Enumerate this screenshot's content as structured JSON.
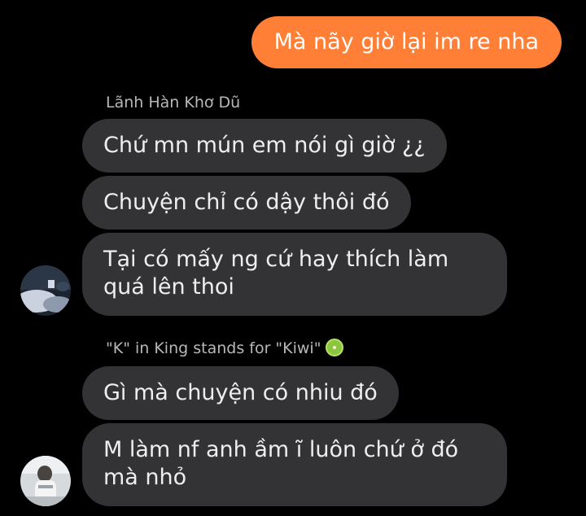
{
  "outgoing": {
    "message": "Mà nãy giờ lại im re nha"
  },
  "groups": [
    {
      "sender": "Lãnh Hàn Khơ Dũ",
      "messages": [
        "Chứ mn mún em nói gì giờ ¿¿",
        "Chuyện chỉ có dậy thôi đó",
        "Tại có mấy ng cứ hay thích làm quá lên thoi"
      ]
    },
    {
      "sender": "\"K\" in King stands for \"Kiwi\"",
      "sender_emoji": "kiwi-icon",
      "messages": [
        "Gì mà chuyện có nhiu đó",
        "M làm nf anh ầm ĩ luôn chứ ở đó mà nhỏ"
      ]
    }
  ],
  "colors": {
    "outgoing_bubble": "#ff7f36",
    "incoming_bubble": "#333336",
    "background": "#000000",
    "sender_text": "#b8b8b8"
  }
}
